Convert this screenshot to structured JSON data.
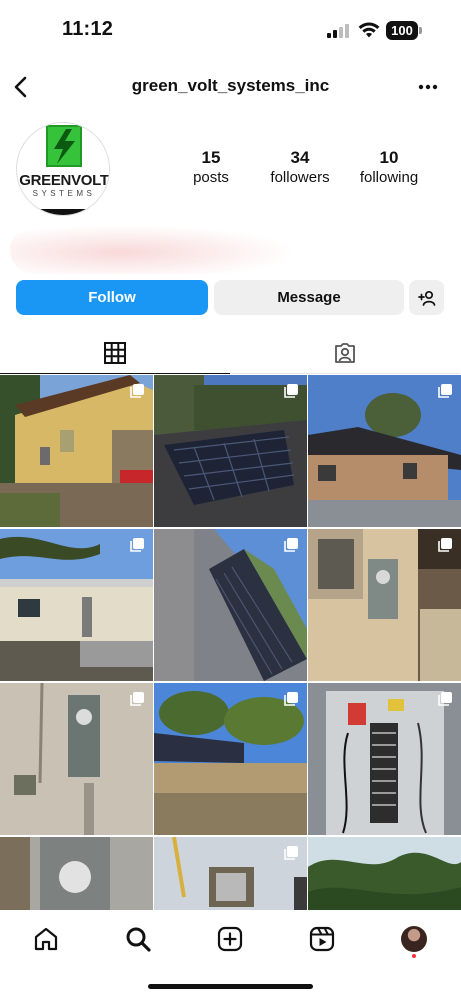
{
  "status_bar": {
    "time": "11:12",
    "battery": "100"
  },
  "header": {
    "username": "green_volt_systems_inc",
    "back_icon": "chevron-left-icon",
    "more_icon": "more-horizontal-icon"
  },
  "profile": {
    "logo_word_green": "GREEN",
    "logo_word_volt": "VOLT",
    "logo_subtitle": "SYSTEMS",
    "brand_color": "#2fb833",
    "stats": [
      {
        "value": "15",
        "label": "posts"
      },
      {
        "value": "34",
        "label": "followers"
      },
      {
        "value": "10",
        "label": "following"
      }
    ]
  },
  "actions": {
    "follow_label": "Follow",
    "message_label": "Message",
    "follow_color": "#1a97f5",
    "add_user_icon": "add-user-icon"
  },
  "tabs": [
    {
      "icon": "grid-icon",
      "selected": true
    },
    {
      "icon": "tagged-icon",
      "selected": false
    }
  ],
  "posts": [
    {
      "subject": "yellow house side yard",
      "multi": true
    },
    {
      "subject": "rooftop solar panels",
      "multi": true
    },
    {
      "subject": "house with roof panels",
      "multi": true
    },
    {
      "subject": "house rear yard",
      "multi": true
    },
    {
      "subject": "solar array roof angle",
      "multi": true
    },
    {
      "subject": "electric meter on wall",
      "multi": true
    },
    {
      "subject": "gray meter on stucco",
      "multi": true
    },
    {
      "subject": "ground mount solar",
      "multi": true
    },
    {
      "subject": "electrical panel",
      "multi": true
    },
    {
      "subject": "meter closeup",
      "multi": false
    },
    {
      "subject": "wall fixture",
      "multi": true
    },
    {
      "subject": "trees",
      "multi": false
    }
  ],
  "bottom_nav": [
    {
      "icon": "home-icon"
    },
    {
      "icon": "search-icon"
    },
    {
      "icon": "create-icon"
    },
    {
      "icon": "reels-icon"
    },
    {
      "icon": "profile-avatar"
    }
  ]
}
